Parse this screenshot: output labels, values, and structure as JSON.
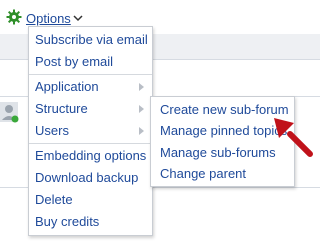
{
  "options_label": "Options",
  "menu": {
    "items": [
      {
        "label": "Subscribe via email"
      },
      {
        "label": "Post by email"
      },
      {
        "label": "Application",
        "has_submenu": true
      },
      {
        "label": "Structure",
        "has_submenu": true
      },
      {
        "label": "Users",
        "has_submenu": true
      },
      {
        "label": "Embedding options"
      },
      {
        "label": "Download backup"
      },
      {
        "label": "Delete"
      },
      {
        "label": "Buy credits"
      }
    ]
  },
  "submenu": {
    "items": [
      {
        "label": "Create new sub-forum"
      },
      {
        "label": "Manage pinned topics"
      },
      {
        "label": "Manage sub-forums"
      },
      {
        "label": "Change parent"
      }
    ]
  },
  "colors": {
    "link": "#1f4a9a",
    "annotation_arrow": "#c0121a",
    "gear": "#2f8f2a"
  },
  "icons": [
    "gear-icon",
    "chevron-down-icon",
    "chevron-right-icon",
    "avatar-icon",
    "annotation-arrow-icon"
  ]
}
